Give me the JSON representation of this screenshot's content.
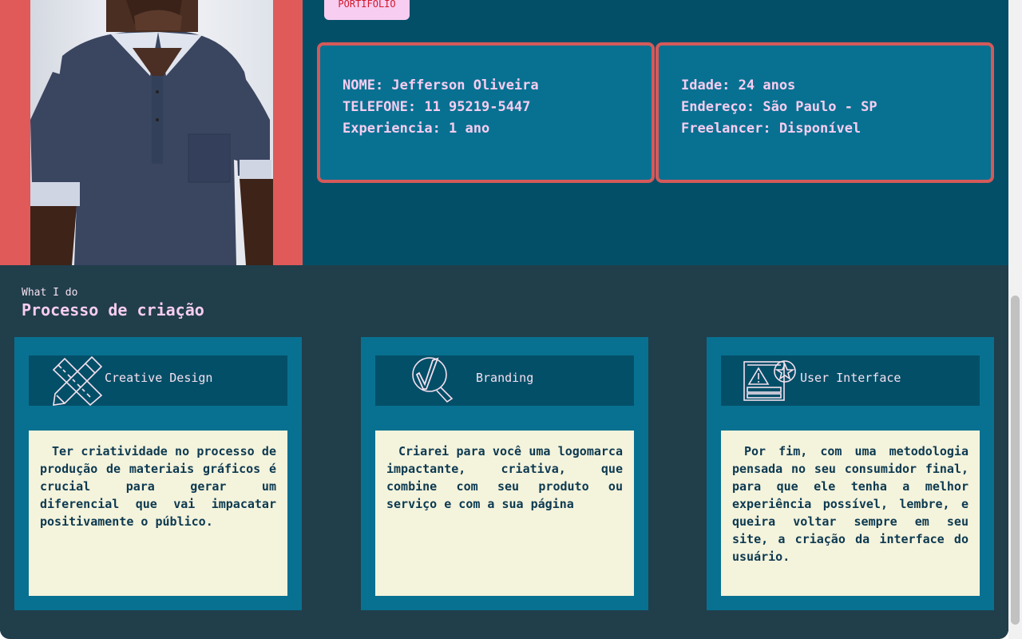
{
  "hero": {
    "portfolio_tab": "PORTIFOLIO",
    "card_left": {
      "lines": [
        "NOME: Jefferson Oliveira",
        "TELEFONE: 11 95219-5447",
        "Experiencia: 1 ano"
      ]
    },
    "card_right": {
      "lines": [
        "Idade: 24 anos",
        "Endereço: São Paulo - SP",
        "Freelancer: Disponível"
      ]
    }
  },
  "section": {
    "subtitle": "What I do",
    "title": "Processo de criação"
  },
  "services": [
    {
      "title": "Creative Design",
      "icon": "ruler-pencil-icon",
      "text": "Ter criatividade no processo de produção de materiais gráficos é crucial para gerar um diferencial que vai impacatar positivamente o público."
    },
    {
      "title": "Branding",
      "icon": "magnifier-check-icon",
      "text": "Criarei para você uma logomarca impactante, criativa, que combine com seu produto ou serviço e com a sua página"
    },
    {
      "title": "User Interface",
      "icon": "ui-warning-icon",
      "text": "Por fim, com uma metodologia pensada no seu consumidor final, para que ele tenha a melhor experiência possível, lembre, e queira voltar sempre em seu site, a criação da interface do usuário."
    }
  ],
  "colors": {
    "hero_bg": "#044f68",
    "card_bg": "#087191",
    "accent_border": "#d45a5a",
    "pink_text": "#f7cdf1",
    "page_bg": "#213e4b",
    "body_card_bg": "#f4f3dc"
  }
}
